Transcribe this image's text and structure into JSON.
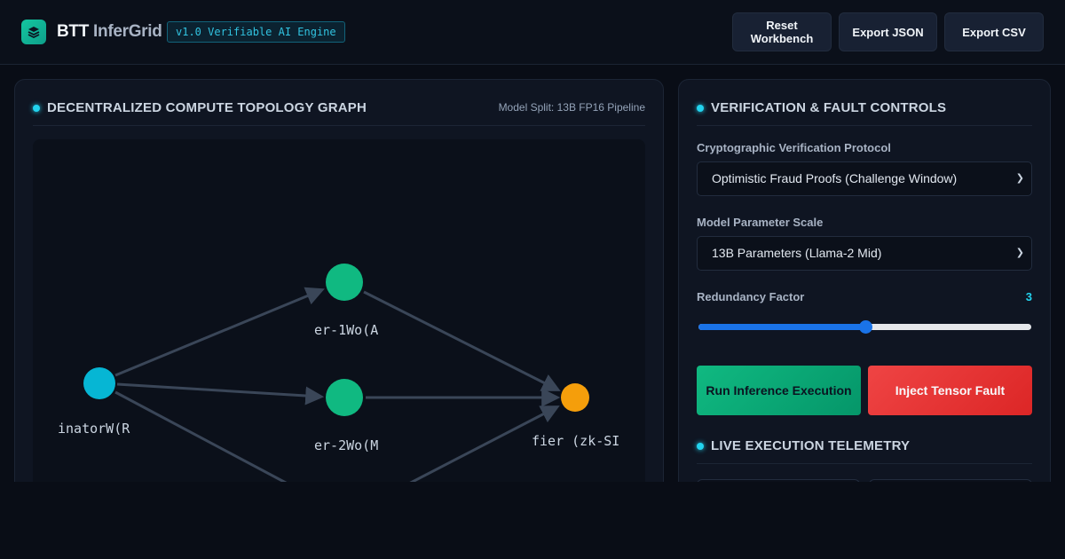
{
  "header": {
    "brand_primary": "BTT",
    "brand_secondary": "InferGrid",
    "version": "v1.0 Verifiable AI Engine",
    "buttons": {
      "reset": "Reset Workbench",
      "export_json": "Export JSON",
      "export_csv": "Export CSV"
    }
  },
  "topology": {
    "title": "DECENTRALIZED COMPUTE TOPOLOGY GRAPH",
    "model_split": "Model Split: 13B FP16 Pipeline",
    "nodes": [
      {
        "id": "coordinator",
        "label": "inatorW(R",
        "color": "#06b6d4"
      },
      {
        "id": "worker1",
        "label": "er-1Wo(A",
        "color": "#10b981"
      },
      {
        "id": "worker2",
        "label": "er-2Wo(M",
        "color": "#10b981"
      },
      {
        "id": "verifier",
        "label": "fier (zk-SI",
        "color": "#f59e0b"
      }
    ]
  },
  "controls": {
    "title": "VERIFICATION & FAULT CONTROLS",
    "protocol_label": "Cryptographic Verification Protocol",
    "protocol_value": "Optimistic Fraud Proofs (Challenge Window)",
    "scale_label": "Model Parameter Scale",
    "scale_value": "13B Parameters (Llama-2 Mid)",
    "redundancy_label": "Redundancy Factor",
    "redundancy_value": "3",
    "redundancy_fraction": 0.5,
    "run_button": "Run Inference Execution",
    "fault_button": "Inject Tensor Fault"
  },
  "telemetry": {
    "title": "LIVE EXECUTION TELEMETRY"
  }
}
